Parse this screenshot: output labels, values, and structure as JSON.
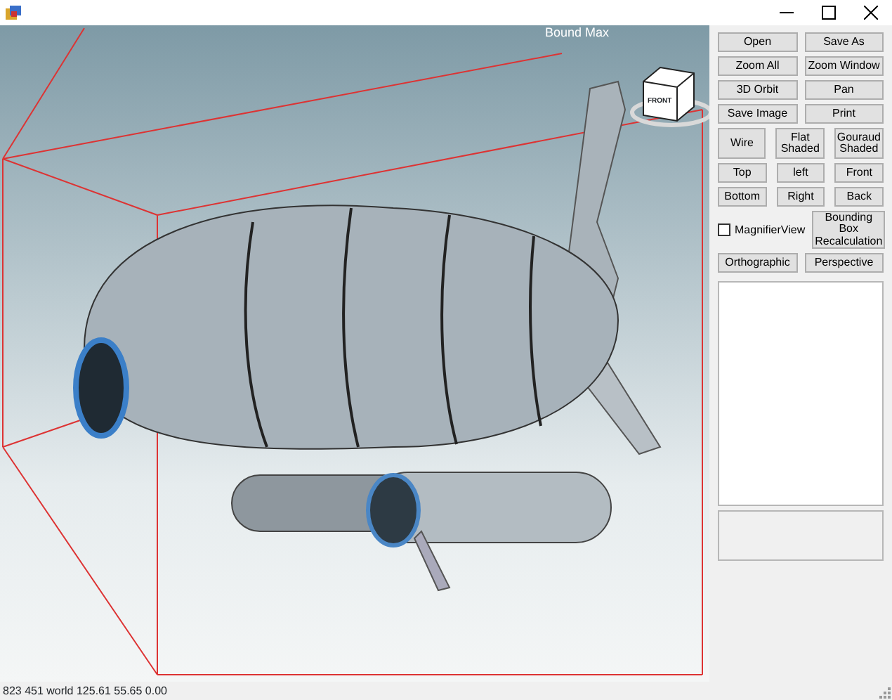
{
  "viewport": {
    "bound_label": "Bound Max",
    "view_cube": {
      "face": "FRONT"
    }
  },
  "panel": {
    "rows": [
      [
        {
          "kind": "button",
          "label": "Open"
        },
        {
          "kind": "button",
          "label": "Save As"
        }
      ],
      [
        {
          "kind": "button",
          "label": "Zoom All"
        },
        {
          "kind": "button",
          "label": "Zoom Window"
        }
      ],
      [
        {
          "kind": "button",
          "label": "3D Orbit"
        },
        {
          "kind": "button",
          "label": "Pan"
        }
      ],
      [
        {
          "kind": "button",
          "label": "Save Image"
        },
        {
          "kind": "button",
          "label": "Print"
        }
      ],
      [
        {
          "kind": "button",
          "label": "Wire"
        },
        {
          "kind": "button",
          "label": "Flat Shaded"
        },
        {
          "kind": "button",
          "label": "Gouraud Shaded"
        }
      ],
      [
        {
          "kind": "button",
          "label": "Top"
        },
        {
          "kind": "button",
          "label": "left"
        },
        {
          "kind": "button",
          "label": "Front"
        }
      ],
      [
        {
          "kind": "button",
          "label": "Bottom"
        },
        {
          "kind": "button",
          "label": "Right"
        },
        {
          "kind": "button",
          "label": "Back"
        }
      ],
      [
        {
          "kind": "checkbox",
          "label": "MagnifierView",
          "checked": false
        },
        {
          "kind": "button",
          "label": "Bounding Box Recalculation"
        }
      ],
      [
        {
          "kind": "button",
          "label": "Orthographic"
        },
        {
          "kind": "button",
          "label": "Perspective"
        }
      ]
    ]
  },
  "status_bar": {
    "text": "823  451 world 125.61 55.65 0.00"
  }
}
